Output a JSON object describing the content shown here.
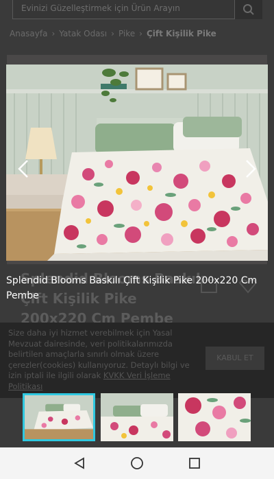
{
  "background": {
    "search_placeholder": "Evinizi Güzelleştirmek için Ürün Arayın",
    "breadcrumb": [
      "Anasayfa",
      "Yatak Odası",
      "Pike",
      "Çift Kişilik Pike"
    ],
    "product_title": "Splendid Blooms Baskılı Çift Kişilik Pike 200x220 Cm Pembe",
    "cookie_text": "Size daha iyi hizmet verebilmek için Yasal Mevzuat dairesinde, veri politikalarımızda belirtilen amaçlarla sınırlı olmak üzere çerezler(cookies) kullanıyoruz. Detaylı bilgi ve izin iptali ile ilgili olarak",
    "cookie_link": "KVKK Veri İşleme Politikası",
    "cookie_button": "KABUL ET"
  },
  "lightbox": {
    "caption": "Splendid Blooms Baskılı Çift Kişilik Pike 200x220 Cm Pembe",
    "prev_icon": "chevron-left-icon",
    "next_icon": "chevron-right-icon",
    "active_thumbnail": 1,
    "accent_color": "#2fc8e0"
  },
  "system_nav": {
    "back_icon": "triangle-back-icon",
    "home_icon": "circle-home-icon",
    "recents_icon": "square-recents-icon"
  }
}
